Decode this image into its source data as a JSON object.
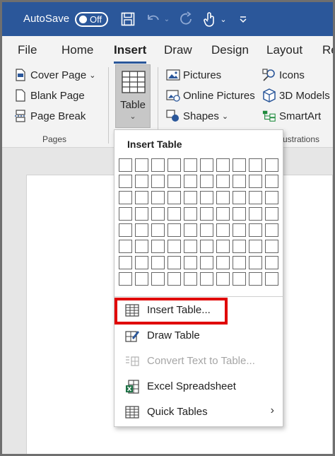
{
  "titlebar": {
    "autosave_label": "AutoSave",
    "autosave_state": "Off",
    "icons": [
      "save-icon",
      "undo-icon",
      "redo-icon",
      "touch-mode-icon",
      "customize-qat-icon"
    ]
  },
  "tabs": [
    "File",
    "Home",
    "Insert",
    "Draw",
    "Design",
    "Layout",
    "Re"
  ],
  "active_tab": "Insert",
  "ribbon": {
    "pages_group": {
      "cover_page": "Cover Page",
      "blank_page": "Blank Page",
      "page_break": "Page Break",
      "label": "Pages"
    },
    "table_button": "Table",
    "illustrations_group": {
      "pictures": "Pictures",
      "online_pictures": "Online Pictures",
      "shapes": "Shapes",
      "icons": "Icons",
      "models_3d": "3D Models",
      "smartart": "SmartArt",
      "label": "ustrations"
    }
  },
  "dropdown": {
    "title": "Insert Table",
    "grid_cols": 10,
    "grid_rows": 8,
    "items": {
      "insert_table": "Insert Table...",
      "draw_table": "Draw Table",
      "convert_text": "Convert Text to Table...",
      "excel_spreadsheet": "Excel Spreadsheet",
      "quick_tables": "Quick Tables"
    }
  },
  "colors": {
    "titlebar": "#2b579a",
    "highlight": "#e00000",
    "ribbon": "#f3f3f3"
  }
}
